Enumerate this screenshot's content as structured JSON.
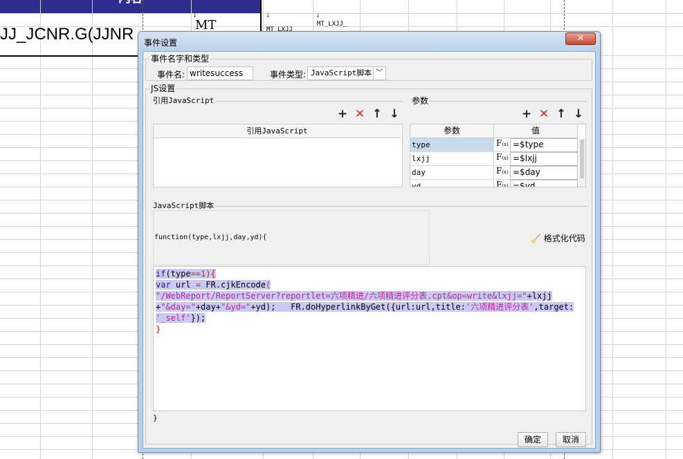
{
  "sheet": {
    "header_text": "内容",
    "big_cell": "JJ_JCNR.G(JJNR",
    "mt_cell": "MT",
    "small_cell_1": "MT_LXJJ",
    "small_cell_2": "MT_LXJJ_"
  },
  "dialog": {
    "title": "事件设置",
    "close_label": "✕",
    "event_group": {
      "legend": "事件名字和类型",
      "name_label": "事件名:",
      "name_value": "writesuccess",
      "type_label": "事件类型:",
      "type_value": "JavaScript脚本"
    },
    "js_group": {
      "legend": "JS设置",
      "ref_group": {
        "legend": "引用JavaScript",
        "column_header": "引用JavaScript"
      },
      "param_group": {
        "legend": "参数",
        "col_name": "参数",
        "col_value": "值",
        "rows": [
          {
            "name": "type",
            "fx": "F",
            "value": "=$type"
          },
          {
            "name": "lxjj",
            "fx": "F",
            "value": "=$lxjj"
          },
          {
            "name": "day",
            "fx": "F",
            "value": "=$day"
          },
          {
            "name": "yd",
            "fx": "F",
            "value": "=$yd"
          }
        ]
      },
      "script_group": {
        "legend": "JavaScript脚本",
        "signature": "function(type,lxjj,day,yd){",
        "format_button": "格式化代码",
        "code": {
          "l1_a": "if",
          "l1_b": "(type",
          "l1_c": "==",
          "l1_d": "1",
          "l1_e": "){",
          "l2_a": "var",
          "l2_b": " url ",
          "l2_c": "=",
          "l2_d": " FR.cjkEncode",
          "l2_e": "(",
          "l3_a": "\"/WebReport/ReportServer?reportlet=六项精进/六项精进评分表.cpt&op=write&lxjj=\"",
          "l3_b": "+lxjj",
          "l4_a": "+",
          "l4_b": "\"&day=\"",
          "l4_c": "+day+",
          "l4_d": "\"&yd=\"",
          "l4_e": "+yd);   FR.doHyperlinkByGet({url:url,title:",
          "l4_f": "'六项精进评分表'",
          "l4_g": ",target:",
          "l5_a": "'_self'",
          "l5_b": "});",
          "l6_a": "}"
        },
        "closing": "}"
      }
    },
    "ok_button": "确定",
    "cancel_button": "取消"
  }
}
